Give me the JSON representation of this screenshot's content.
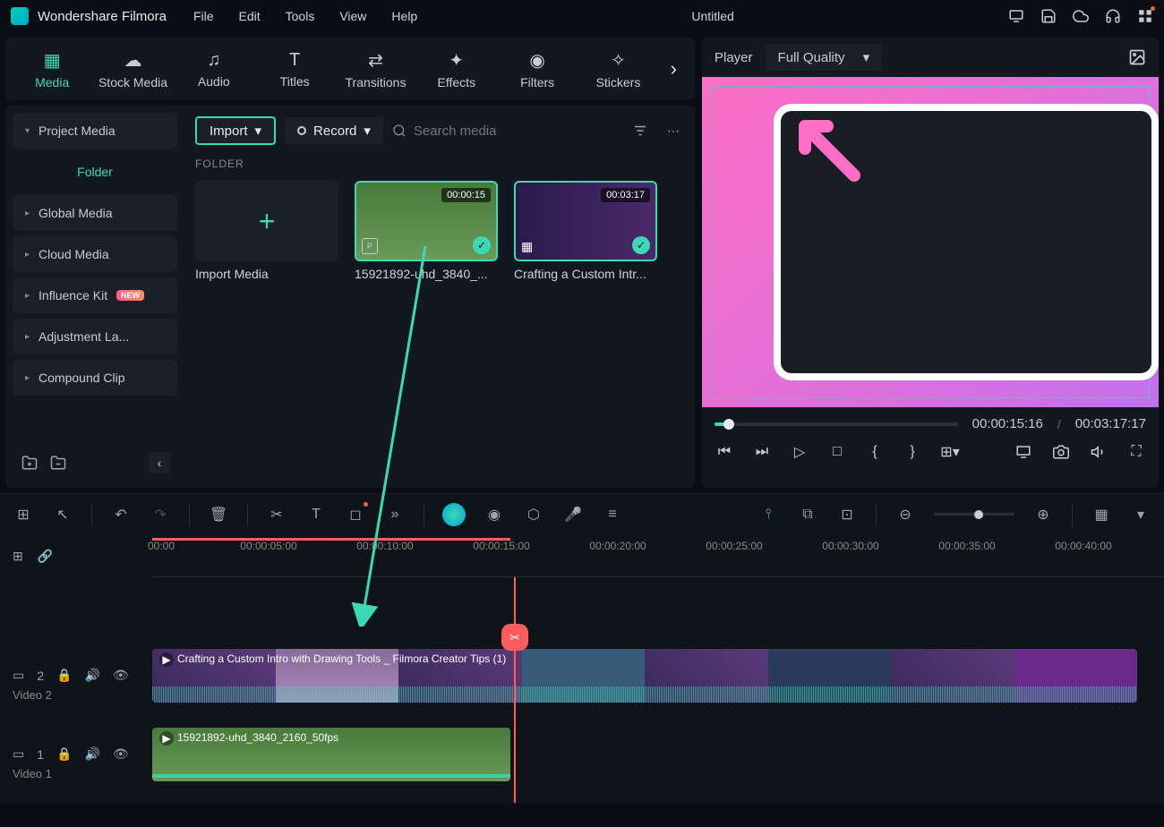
{
  "app": {
    "name": "Wondershare Filmora",
    "doc_title": "Untitled"
  },
  "menus": [
    "File",
    "Edit",
    "Tools",
    "View",
    "Help"
  ],
  "tabs": [
    {
      "label": "Media",
      "active": true
    },
    {
      "label": "Stock Media"
    },
    {
      "label": "Audio"
    },
    {
      "label": "Titles"
    },
    {
      "label": "Transitions"
    },
    {
      "label": "Effects"
    },
    {
      "label": "Filters"
    },
    {
      "label": "Stickers"
    }
  ],
  "sidebar": {
    "project": "Project Media",
    "folder": "Folder",
    "items": [
      {
        "label": "Global Media"
      },
      {
        "label": "Cloud Media"
      },
      {
        "label": "Influence Kit",
        "badge": "NEW"
      },
      {
        "label": "Adjustment La..."
      },
      {
        "label": "Compound Clip"
      }
    ]
  },
  "content": {
    "import": "Import",
    "record": "Record",
    "search_placeholder": "Search media",
    "folder_label": "FOLDER",
    "cards": [
      {
        "type": "import",
        "caption": "Import Media"
      },
      {
        "type": "clip",
        "duration": "00:00:15",
        "caption": "15921892-uhd_3840_...",
        "selected": true,
        "proxy": true
      },
      {
        "type": "clip",
        "duration": "00:03:17",
        "caption": "Crafting a Custom Intr...",
        "selected": false
      }
    ]
  },
  "player": {
    "label": "Player",
    "quality": "Full Quality",
    "current": "00:00:15:16",
    "total": "00:03:17:17"
  },
  "ruler": {
    "labels": [
      "00:00",
      "00:00:05:00",
      "00:00:10:00",
      "00:00:15:00",
      "00:00:20:00",
      "00:00:25:00",
      "00:00:30:00",
      "00:00:35:00",
      "00:00:40:00"
    ]
  },
  "tracks": {
    "v2": {
      "name": "Video 2",
      "num": "2",
      "clip_title": "Crafting a Custom Intro with Drawing Tools _ Filmora Creator Tips (1)"
    },
    "v1": {
      "name": "Video 1",
      "num": "1",
      "clip_title": "15921892-uhd_3840_2160_50fps"
    }
  }
}
